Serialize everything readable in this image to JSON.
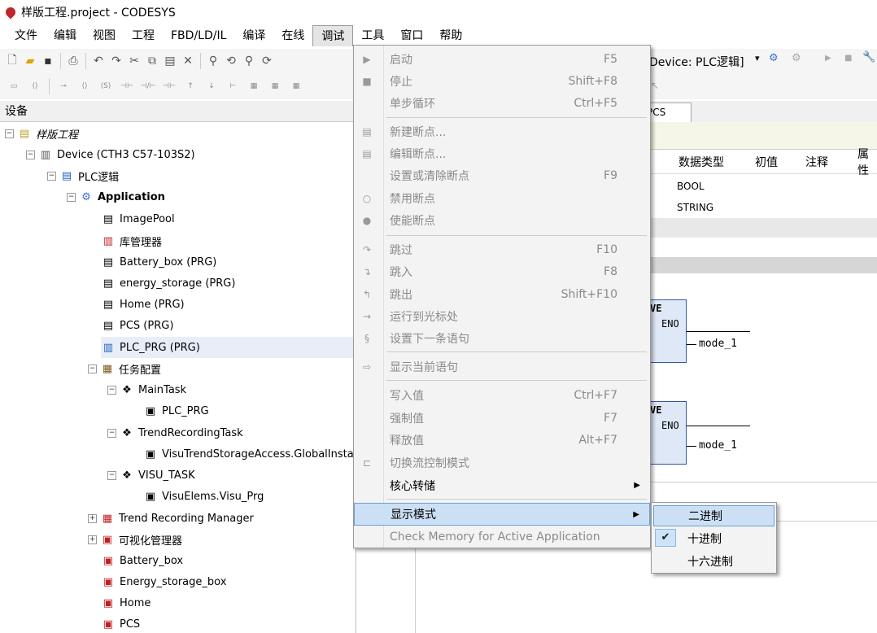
{
  "window": {
    "title": "样版工程.project - CODESYS"
  },
  "menubar": [
    "文件",
    "编辑",
    "视图",
    "工程",
    "FBD/LD/IL",
    "编译",
    "在线",
    "调试",
    "工具",
    "窗口",
    "帮助"
  ],
  "toolbar": {
    "device_selector": "Device: PLC逻辑]"
  },
  "device_panel": {
    "title": "设备",
    "tree": [
      {
        "label": "样版工程"
      },
      {
        "label": "Device (CTH3 C57-103S2)"
      },
      {
        "label": "PLC逻辑"
      },
      {
        "label": "Application"
      },
      {
        "label": "ImagePool"
      },
      {
        "label": "库管理器"
      },
      {
        "label": "Battery_box (PRG)"
      },
      {
        "label": "energy_storage (PRG)"
      },
      {
        "label": "Home (PRG)"
      },
      {
        "label": "PCS (PRG)"
      },
      {
        "label": "PLC_PRG (PRG)"
      },
      {
        "label": "任务配置"
      },
      {
        "label": "MainTask"
      },
      {
        "label": "PLC_PRG"
      },
      {
        "label": "TrendRecordingTask"
      },
      {
        "label": "VisuTrendStorageAccess.GlobalInstances"
      },
      {
        "label": "VISU_TASK"
      },
      {
        "label": "VisuElems.Visu_Prg"
      },
      {
        "label": "Trend Recording Manager"
      },
      {
        "label": "可视化管理器"
      },
      {
        "label": "Battery_box"
      },
      {
        "label": "Energy_storage_box"
      },
      {
        "label": "Home"
      },
      {
        "label": "PCS"
      }
    ]
  },
  "editor": {
    "tab": "PCS",
    "columns": [
      "数据类型",
      "初值",
      "注释",
      "属性"
    ],
    "rows": [
      [
        "BOOL"
      ],
      [
        "STRING"
      ]
    ],
    "fbd": [
      {
        "box_name": "VE",
        "pin": "ENO",
        "output": "mode_1"
      },
      {
        "box_name": "VE",
        "pin": "ENO",
        "output": "mode_1"
      }
    ]
  },
  "debug_menu": {
    "items": [
      {
        "label": "启动",
        "key": "F5"
      },
      {
        "label": "停止",
        "key": "Shift+F8"
      },
      {
        "label": "单步循环",
        "key": "Ctrl+F5"
      },
      {
        "label": "新建断点...",
        "key": ""
      },
      {
        "label": "编辑断点...",
        "key": ""
      },
      {
        "label": "设置或清除断点",
        "key": "F9"
      },
      {
        "label": "禁用断点",
        "key": ""
      },
      {
        "label": "使能断点",
        "key": ""
      },
      {
        "label": "跳过",
        "key": "F10"
      },
      {
        "label": "跳入",
        "key": "F8"
      },
      {
        "label": "跳出",
        "key": "Shift+F10"
      },
      {
        "label": "运行到光标处",
        "key": ""
      },
      {
        "label": "设置下一条语句",
        "key": ""
      },
      {
        "label": "显示当前语句",
        "key": ""
      },
      {
        "label": "写入值",
        "key": "Ctrl+F7"
      },
      {
        "label": "强制值",
        "key": "F7"
      },
      {
        "label": "释放值",
        "key": "Alt+F7"
      },
      {
        "label": "切换流控制模式",
        "key": ""
      },
      {
        "label": "核心转储",
        "key": ""
      },
      {
        "label": "显示模式",
        "key": ""
      },
      {
        "label": "Check Memory for Active Application",
        "key": ""
      }
    ]
  },
  "display_mode_submenu": {
    "items": [
      {
        "label": "二进制",
        "checked": false
      },
      {
        "label": "十进制",
        "checked": true
      },
      {
        "label": "十六进制",
        "checked": false
      }
    ],
    "check_glyph": "✔"
  },
  "colors": {
    "menu_highlight": "#cce0f5",
    "disabled_text": "#8a8a8a",
    "accent": "#c0262b"
  }
}
